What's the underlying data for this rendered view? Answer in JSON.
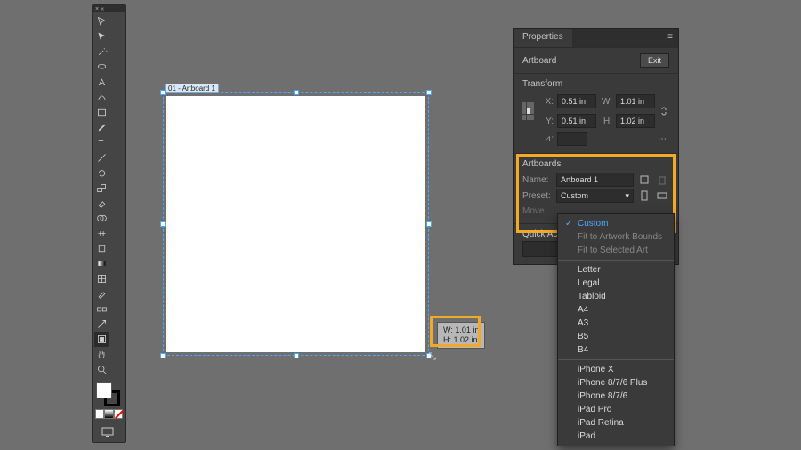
{
  "toolbar_header": {
    "close": "×",
    "collapse": "«"
  },
  "artboard": {
    "label": "01 - Artboard 1",
    "size_tip_w": "W: 1.01 in",
    "size_tip_h": "H: 1.02 in"
  },
  "panel": {
    "tab": "Properties",
    "menu": "≡",
    "selection": "Artboard",
    "exit_btn": "Exit",
    "transform": {
      "title": "Transform",
      "x_label": "X:",
      "x": "0.51 in",
      "y_label": "Y:",
      "y": "0.51 in",
      "w_label": "W:",
      "w": "1.01 in",
      "h_label": "H:",
      "h": "1.02 in",
      "rot_label": "⊿:"
    },
    "artboards": {
      "title": "Artboards",
      "name_label": "Name:",
      "name_value": "Artboard 1",
      "preset_label": "Preset:",
      "preset_value": "Custom",
      "move_label": "Move...",
      "quick_label": "Quick Act…"
    }
  },
  "preset_menu": {
    "items": [
      {
        "label": "Custom",
        "sel": true
      },
      {
        "label": "Fit to Artwork Bounds",
        "dim": true
      },
      {
        "label": "Fit to Selected Art",
        "dim": true
      },
      {
        "sep": true
      },
      {
        "label": "Letter"
      },
      {
        "label": "Legal"
      },
      {
        "label": "Tabloid"
      },
      {
        "label": "A4"
      },
      {
        "label": "A3"
      },
      {
        "label": "B5"
      },
      {
        "label": "B4"
      },
      {
        "sep": true
      },
      {
        "label": "iPhone X"
      },
      {
        "label": "iPhone 8/7/6 Plus"
      },
      {
        "label": "iPhone 8/7/6"
      },
      {
        "label": "iPad Pro"
      },
      {
        "label": "iPad Retina"
      },
      {
        "label": "iPad"
      }
    ]
  }
}
